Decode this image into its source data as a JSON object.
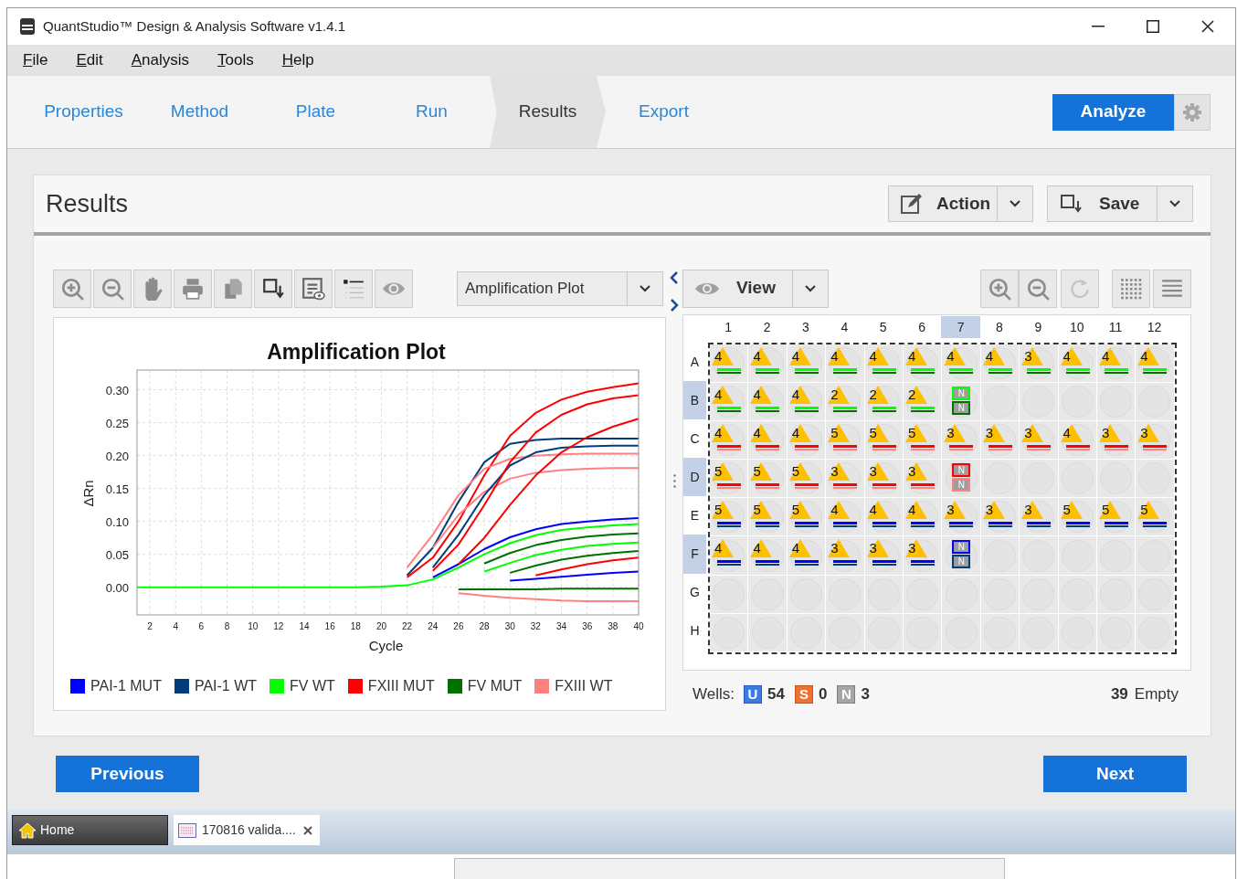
{
  "window": {
    "title": "QuantStudio™ Design & Analysis Software v1.4.1"
  },
  "menu": [
    "File",
    "Edit",
    "Analysis",
    "Tools",
    "Help"
  ],
  "tabs": [
    {
      "label": "Properties",
      "selected": false
    },
    {
      "label": "Method",
      "selected": false
    },
    {
      "label": "Plate",
      "selected": false
    },
    {
      "label": "Run",
      "selected": false
    },
    {
      "label": "Results",
      "selected": true
    },
    {
      "label": "Export",
      "selected": false
    }
  ],
  "analyze_button": "Analyze",
  "panel": {
    "title": "Results",
    "action_button": "Action",
    "save_button": "Save"
  },
  "plot": {
    "dropdown": "Amplification Plot",
    "chart_data": {
      "type": "line",
      "title": "Amplification Plot",
      "xlabel": "Cycle",
      "ylabel": "ΔRn",
      "grid": true,
      "legend": true,
      "x": [
        1,
        4,
        8,
        12,
        16,
        18,
        20,
        22,
        24,
        26,
        28,
        30,
        32,
        34,
        36,
        38,
        40
      ],
      "xlim": [
        1,
        40
      ],
      "ylim": [
        -0.042,
        0.33
      ],
      "xticks": [
        2,
        4,
        6,
        8,
        10,
        12,
        14,
        16,
        18,
        20,
        22,
        24,
        26,
        28,
        30,
        32,
        34,
        36,
        38,
        40
      ],
      "yticks": [
        {
          "value": 0,
          "label": "0.00"
        },
        {
          "value": 0.05,
          "label": "0.05"
        },
        {
          "value": 0.1,
          "label": "0.10"
        },
        {
          "value": 0.15,
          "label": "0.15"
        },
        {
          "value": 0.2,
          "label": "0.20"
        },
        {
          "value": 0.25,
          "label": "0.25"
        },
        {
          "value": 0.3,
          "label": "0.30"
        }
      ],
      "series": [
        {
          "name": "PAI-1 MUT",
          "color": "#0000ff",
          "values": [
            null,
            null,
            null,
            null,
            null,
            null,
            null,
            null,
            0.015,
            0.035,
            0.058,
            0.076,
            0.088,
            0.096,
            0.1,
            0.103,
            0.105
          ]
        },
        {
          "name": "PAI-1 WT",
          "color": "#003d7a",
          "values": [
            null,
            null,
            null,
            null,
            null,
            null,
            null,
            0.018,
            0.06,
            0.13,
            0.19,
            0.218,
            0.224,
            0.226,
            0.226,
            0.226,
            0.226
          ]
        },
        {
          "name": "FV WT",
          "color": "#00ff00",
          "values": [
            0,
            0,
            0,
            0,
            0,
            0,
            0.001,
            0.003,
            0.012,
            0.03,
            0.05,
            0.067,
            0.079,
            0.087,
            0.091,
            0.094,
            0.096
          ]
        },
        {
          "name": "FXIII MUT",
          "color": "#ff0000",
          "values": [
            null,
            null,
            null,
            null,
            null,
            null,
            null,
            0.015,
            0.045,
            0.1,
            0.17,
            0.23,
            0.265,
            0.285,
            0.297,
            0.304,
            0.31
          ]
        },
        {
          "name": "FV MUT",
          "color": "#007000",
          "values": [
            null,
            null,
            null,
            null,
            null,
            null,
            null,
            null,
            null,
            null,
            0.036,
            0.052,
            0.064,
            0.072,
            0.077,
            0.08,
            0.082
          ]
        },
        {
          "name": "FXIII WT",
          "color": "#ff8080",
          "values": [
            null,
            null,
            null,
            null,
            null,
            null,
            null,
            0.03,
            0.08,
            0.14,
            0.18,
            0.195,
            0.2,
            0.202,
            0.203,
            0.203,
            0.203
          ]
        },
        {
          "color": "#ff8080",
          "values": [
            null,
            null,
            null,
            null,
            null,
            null,
            null,
            null,
            0.06,
            0.11,
            0.145,
            0.165,
            0.174,
            0.178,
            0.18,
            0.181,
            0.181
          ]
        },
        {
          "color": "#ff8080",
          "values": [
            null,
            null,
            null,
            null,
            null,
            null,
            null,
            null,
            null,
            -0.009,
            -0.013,
            -0.016,
            -0.018,
            -0.02,
            -0.021,
            -0.021,
            -0.021
          ]
        },
        {
          "color": "#003d7a",
          "values": [
            null,
            null,
            null,
            null,
            null,
            null,
            null,
            null,
            0.03,
            0.08,
            0.14,
            0.185,
            0.205,
            0.212,
            0.214,
            0.215,
            0.215
          ]
        },
        {
          "color": "#0000ff",
          "values": [
            null,
            null,
            null,
            null,
            null,
            null,
            null,
            null,
            null,
            null,
            null,
            0.01,
            0.013,
            0.016,
            0.019,
            0.022,
            0.024
          ]
        },
        {
          "color": "#00ff00",
          "values": [
            null,
            null,
            null,
            null,
            null,
            null,
            null,
            null,
            null,
            null,
            0.024,
            0.037,
            0.049,
            0.057,
            0.063,
            0.066,
            0.068
          ]
        },
        {
          "color": "#007000",
          "values": [
            null,
            null,
            null,
            null,
            null,
            null,
            null,
            null,
            null,
            null,
            null,
            0.022,
            0.033,
            0.042,
            0.048,
            0.052,
            0.055
          ]
        },
        {
          "color": "#007000",
          "values": [
            null,
            null,
            null,
            null,
            null,
            null,
            null,
            null,
            null,
            -0.003,
            -0.003,
            -0.003,
            -0.003,
            -0.002,
            -0.002,
            -0.002,
            -0.002
          ]
        },
        {
          "color": "#ff0000",
          "values": [
            null,
            null,
            null,
            null,
            null,
            null,
            null,
            null,
            0.025,
            0.065,
            0.125,
            0.19,
            0.235,
            0.262,
            0.278,
            0.287,
            0.292
          ]
        },
        {
          "color": "#ff0000",
          "values": [
            null,
            null,
            null,
            null,
            null,
            null,
            null,
            null,
            null,
            0.035,
            0.075,
            0.125,
            0.17,
            0.205,
            0.228,
            0.244,
            0.256
          ]
        },
        {
          "color": "#ff0000",
          "values": [
            null,
            null,
            null,
            null,
            null,
            null,
            null,
            null,
            null,
            null,
            null,
            null,
            0.018,
            0.027,
            0.035,
            0.041,
            0.045
          ]
        }
      ]
    }
  },
  "plate": {
    "view_button": "View",
    "columns": [
      {
        "label": "1",
        "selected": false
      },
      {
        "label": "2",
        "selected": false
      },
      {
        "label": "3",
        "selected": false
      },
      {
        "label": "4",
        "selected": false
      },
      {
        "label": "5",
        "selected": false
      },
      {
        "label": "6",
        "selected": false
      },
      {
        "label": "7",
        "selected": true
      },
      {
        "label": "8",
        "selected": false
      },
      {
        "label": "9",
        "selected": false
      },
      {
        "label": "10",
        "selected": false
      },
      {
        "label": "11",
        "selected": false
      },
      {
        "label": "12",
        "selected": false
      }
    ],
    "rows": [
      {
        "label": "A",
        "selected": false,
        "targets": [
          {
            "color": "#00ff00"
          },
          {
            "color": "#007000"
          }
        ],
        "wells": [
          {
            "kind": "sample",
            "text": "4"
          },
          {
            "kind": "sample",
            "text": "4"
          },
          {
            "kind": "sample",
            "text": "4"
          },
          {
            "kind": "sample",
            "text": "4"
          },
          {
            "kind": "sample",
            "text": "4"
          },
          {
            "kind": "sample",
            "text": "4"
          },
          {
            "kind": "sample",
            "text": "4"
          },
          {
            "kind": "sample",
            "text": "4"
          },
          {
            "kind": "sample",
            "text": "3"
          },
          {
            "kind": "sample",
            "text": "4"
          },
          {
            "kind": "sample",
            "text": "4"
          },
          {
            "kind": "sample",
            "text": "4"
          }
        ]
      },
      {
        "label": "B",
        "selected": true,
        "targets": [
          {
            "color": "#00ff00"
          },
          {
            "color": "#007000"
          }
        ],
        "wells": [
          {
            "kind": "sample",
            "text": "4"
          },
          {
            "kind": "sample",
            "text": "4"
          },
          {
            "kind": "sample",
            "text": "4"
          },
          {
            "kind": "sample",
            "text": "2"
          },
          {
            "kind": "sample",
            "text": "2"
          },
          {
            "kind": "sample",
            "text": "2"
          },
          {
            "kind": "ntc",
            "labels": [
              "N",
              "N"
            ]
          },
          {
            "kind": "empty"
          },
          {
            "kind": "empty"
          },
          {
            "kind": "empty"
          },
          {
            "kind": "empty"
          },
          {
            "kind": "empty"
          }
        ]
      },
      {
        "label": "C",
        "selected": false,
        "targets": [
          {
            "color": "#ff0000"
          },
          {
            "color": "#ff8080"
          }
        ],
        "wells": [
          {
            "kind": "sample",
            "text": "4"
          },
          {
            "kind": "sample",
            "text": "4"
          },
          {
            "kind": "sample",
            "text": "4"
          },
          {
            "kind": "sample",
            "text": "5"
          },
          {
            "kind": "sample",
            "text": "5"
          },
          {
            "kind": "sample",
            "text": "5"
          },
          {
            "kind": "sample",
            "text": "3"
          },
          {
            "kind": "sample",
            "text": "3"
          },
          {
            "kind": "sample",
            "text": "3"
          },
          {
            "kind": "sample",
            "text": "4"
          },
          {
            "kind": "sample",
            "text": "3"
          },
          {
            "kind": "sample",
            "text": "3"
          }
        ]
      },
      {
        "label": "D",
        "selected": true,
        "targets": [
          {
            "color": "#ff0000"
          },
          {
            "color": "#ff8080"
          }
        ],
        "wells": [
          {
            "kind": "sample",
            "text": "5"
          },
          {
            "kind": "sample",
            "text": "5"
          },
          {
            "kind": "sample",
            "text": "5"
          },
          {
            "kind": "sample",
            "text": "3"
          },
          {
            "kind": "sample",
            "text": "3"
          },
          {
            "kind": "sample",
            "text": "3"
          },
          {
            "kind": "ntc",
            "labels": [
              "N",
              "N"
            ]
          },
          {
            "kind": "empty"
          },
          {
            "kind": "empty"
          },
          {
            "kind": "empty"
          },
          {
            "kind": "empty"
          },
          {
            "kind": "empty"
          }
        ]
      },
      {
        "label": "E",
        "selected": false,
        "targets": [
          {
            "color": "#0000ff"
          },
          {
            "color": "#003d7a"
          }
        ],
        "wells": [
          {
            "kind": "sample",
            "text": "5"
          },
          {
            "kind": "sample",
            "text": "5"
          },
          {
            "kind": "sample",
            "text": "5"
          },
          {
            "kind": "sample",
            "text": "4"
          },
          {
            "kind": "sample",
            "text": "4"
          },
          {
            "kind": "sample",
            "text": "4"
          },
          {
            "kind": "sample",
            "text": "3"
          },
          {
            "kind": "sample",
            "text": "3"
          },
          {
            "kind": "sample",
            "text": "3"
          },
          {
            "kind": "sample",
            "text": "5"
          },
          {
            "kind": "sample",
            "text": "5"
          },
          {
            "kind": "sample",
            "text": "5"
          }
        ]
      },
      {
        "label": "F",
        "selected": true,
        "targets": [
          {
            "color": "#0000ff"
          },
          {
            "color": "#003d7a"
          }
        ],
        "wells": [
          {
            "kind": "sample",
            "text": "4"
          },
          {
            "kind": "sample",
            "text": "4"
          },
          {
            "kind": "sample",
            "text": "4"
          },
          {
            "kind": "sample",
            "text": "3"
          },
          {
            "kind": "sample",
            "text": "3"
          },
          {
            "kind": "sample",
            "text": "3"
          },
          {
            "kind": "ntc",
            "labels": [
              "N",
              "N"
            ]
          },
          {
            "kind": "empty"
          },
          {
            "kind": "empty"
          },
          {
            "kind": "empty"
          },
          {
            "kind": "empty"
          },
          {
            "kind": "empty"
          }
        ]
      },
      {
        "label": "G",
        "selected": false,
        "wells": [
          {
            "kind": "empty"
          },
          {
            "kind": "empty"
          },
          {
            "kind": "empty"
          },
          {
            "kind": "empty"
          },
          {
            "kind": "empty"
          },
          {
            "kind": "empty"
          },
          {
            "kind": "empty"
          },
          {
            "kind": "empty"
          },
          {
            "kind": "empty"
          },
          {
            "kind": "empty"
          },
          {
            "kind": "empty"
          },
          {
            "kind": "empty"
          }
        ]
      },
      {
        "label": "H",
        "selected": false,
        "wells": [
          {
            "kind": "empty"
          },
          {
            "kind": "empty"
          },
          {
            "kind": "empty"
          },
          {
            "kind": "empty"
          },
          {
            "kind": "empty"
          },
          {
            "kind": "empty"
          },
          {
            "kind": "empty"
          },
          {
            "kind": "empty"
          },
          {
            "kind": "empty"
          },
          {
            "kind": "empty"
          },
          {
            "kind": "empty"
          },
          {
            "kind": "empty"
          }
        ]
      }
    ],
    "summary": {
      "label": "Wells:",
      "counts": [
        {
          "kind": "unknown",
          "badge": "U",
          "count": "54"
        },
        {
          "kind": "standard",
          "badge": "S",
          "count": "0"
        },
        {
          "kind": "ntc",
          "badge": "N",
          "count": "3"
        }
      ],
      "empty_count": "39",
      "empty_label": "Empty"
    }
  },
  "navigation": {
    "previous": "Previous",
    "next": "Next"
  },
  "taskbar": [
    {
      "kind": "home",
      "label": "Home"
    },
    {
      "kind": "file",
      "label": "170816 valida...."
    }
  ]
}
